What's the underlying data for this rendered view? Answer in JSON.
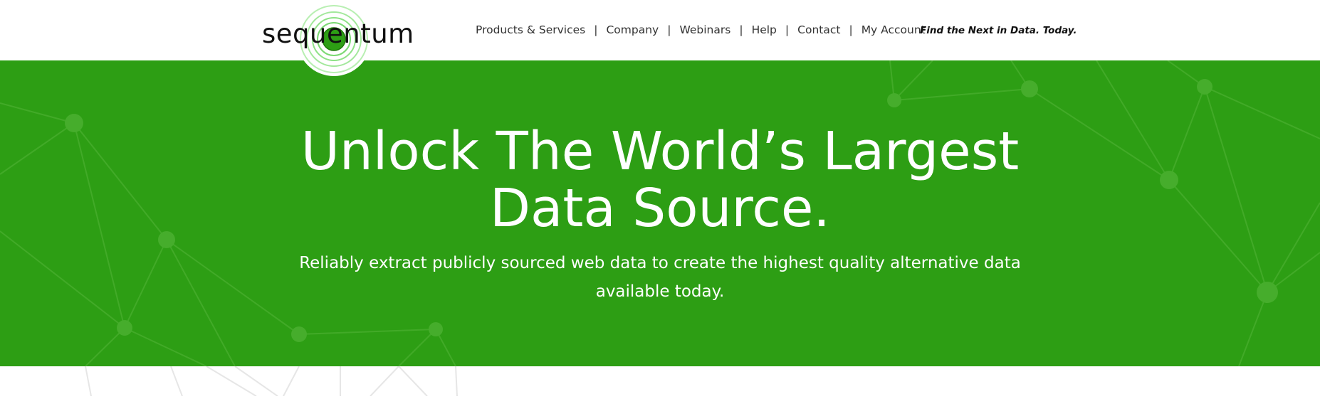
{
  "brand": {
    "logo_text": "sequentum",
    "accent_color": "#2d9e14",
    "logo_ring_color": "#7ee07a"
  },
  "nav": {
    "items": [
      {
        "label": "Products & Services"
      },
      {
        "label": "Company"
      },
      {
        "label": "Webinars"
      },
      {
        "label": "Help"
      },
      {
        "label": "Contact"
      },
      {
        "label": "My Account"
      }
    ],
    "separator": "|"
  },
  "tagline": "Find the Next in Data. Today.",
  "hero": {
    "title_line1": "Unlock The World’s Largest",
    "title_line2": "Data Source.",
    "subtitle_line1": "Reliably extract publicly sourced web data to create the highest quality alternative data",
    "subtitle_line2": "available today.",
    "background_color": "#2d9e14"
  }
}
